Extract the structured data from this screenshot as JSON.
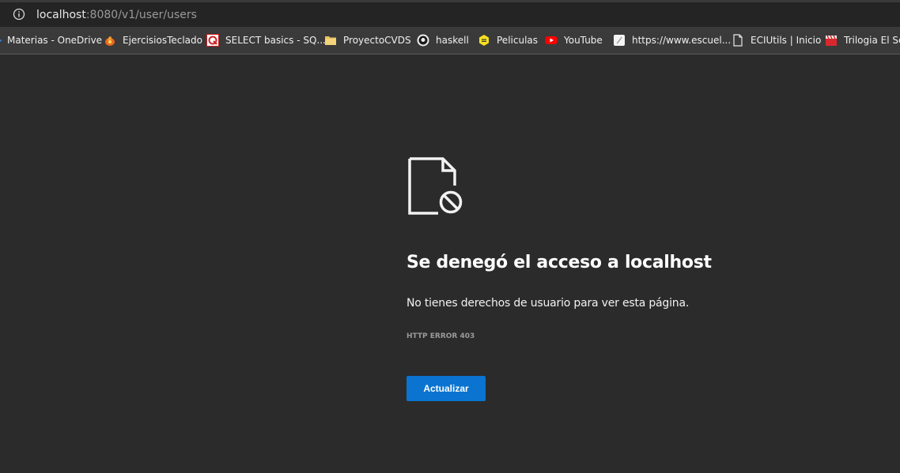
{
  "address_bar": {
    "host": "localhost",
    "path": ":8080/v1/user/users",
    "info_icon": "info-icon"
  },
  "bookmarks": [
    {
      "label": "Materias - OneDrive",
      "icon": "cloud-icon"
    },
    {
      "label": "EjercisiosTeclado",
      "icon": "fire-icon"
    },
    {
      "label": "SELECT basics - SQ...",
      "icon": "quiz-icon"
    },
    {
      "label": "ProyectoCVDS",
      "icon": "folder-icon"
    },
    {
      "label": "haskell",
      "icon": "github-icon"
    },
    {
      "label": "Peliculas",
      "icon": "hexagon-icon"
    },
    {
      "label": "YouTube",
      "icon": "youtube-icon"
    },
    {
      "label": "https://www.escuel...",
      "icon": "page-icon"
    },
    {
      "label": "ECIUtils | Inicio",
      "icon": "document-icon"
    },
    {
      "label": "Trilogia El Señ",
      "icon": "clapperboard-icon"
    }
  ],
  "error_page": {
    "icon": "blocked-document-icon",
    "title": "Se denegó el acceso a localhost",
    "description": "No tienes derechos de usuario para ver esta página.",
    "error_code": "HTTP ERROR 403",
    "button_label": "Actualizar"
  },
  "colors": {
    "background": "#2b2b2b",
    "bookmark_bar": "#3a3a3a",
    "button": "#0a74d0"
  }
}
